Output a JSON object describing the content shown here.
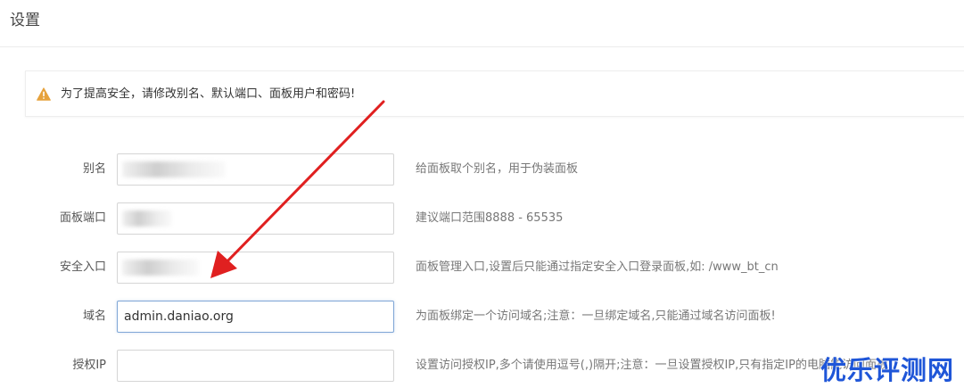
{
  "page": {
    "title": "设置"
  },
  "warning": {
    "icon": "warning-triangle-icon",
    "text": "为了提高安全，请修改别名、默认端口、面板用户和密码!",
    "icon_color": "#e6a23c"
  },
  "form": {
    "rows": [
      {
        "label": "别名",
        "value": "",
        "help": "给面板取个别名，用于伪装面板"
      },
      {
        "label": "面板端口",
        "value": "",
        "help": "建议端口范围8888 - 65535"
      },
      {
        "label": "安全入口",
        "value": "",
        "help": "面板管理入口,设置后只能通过指定安全入口登录面板,如: /www_bt_cn"
      },
      {
        "label": "域名",
        "value": "admin.daniao.org",
        "help": "为面板绑定一个访问域名;注意：一旦绑定域名,只能通过域名访问面板!"
      },
      {
        "label": "授权IP",
        "value": "",
        "help": "设置访问授权IP,多个请使用逗号(,)隔开;注意：一旦设置授权IP,只有指定IP的电脑能访问面板!"
      }
    ]
  },
  "annotation": {
    "arrow_color": "#e02020"
  },
  "watermark": {
    "text": "优乐评测网",
    "color": "#1f56d8"
  }
}
